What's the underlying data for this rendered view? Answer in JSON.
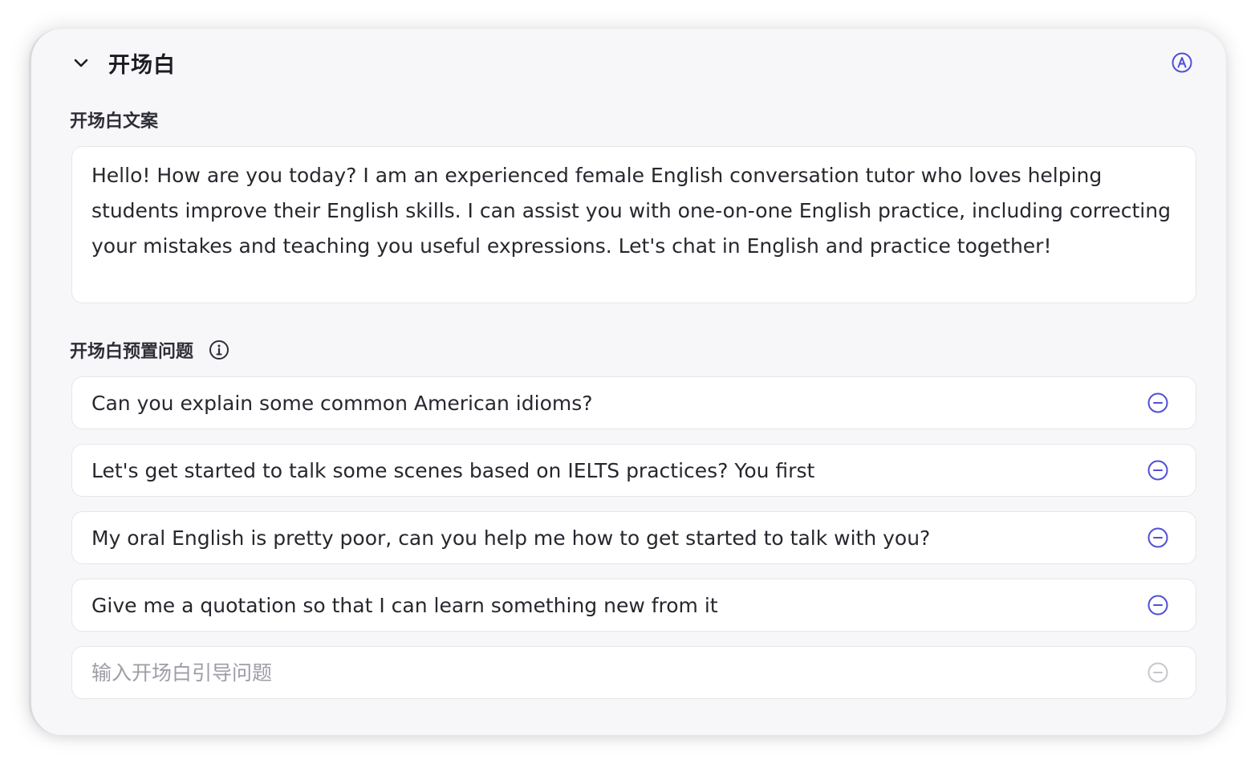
{
  "section": {
    "title": "开场白",
    "collapse_icon": "chevron-down-icon",
    "auto_icon": "auto-a-circle-icon"
  },
  "greeting": {
    "label": "开场白文案",
    "text": "Hello! How are you today? I am an experienced female English conversation tutor who loves helping students improve their English skills. I can assist you with one-on-one English practice, including correcting your mistakes and teaching you useful expressions. Let's chat in English and practice together!"
  },
  "questions": {
    "label": "开场白预置问题",
    "info_icon": "info-circle-icon",
    "remove_icon": "minus-circle-icon",
    "items": [
      "Can you explain some common American idioms?",
      "Let's get started to talk some scenes based on IELTS practices? You first",
      "My oral English is pretty poor, can you help me how to get started to talk with you?",
      "Give me a quotation so that I can learn something new from it"
    ],
    "new_placeholder": "输入开场白引导问题"
  },
  "colors": {
    "accent": "#4f50d6",
    "disabled_icon": "#c7c7cd",
    "panel_bg": "#f7f7f9",
    "field_bg": "#ffffff"
  }
}
